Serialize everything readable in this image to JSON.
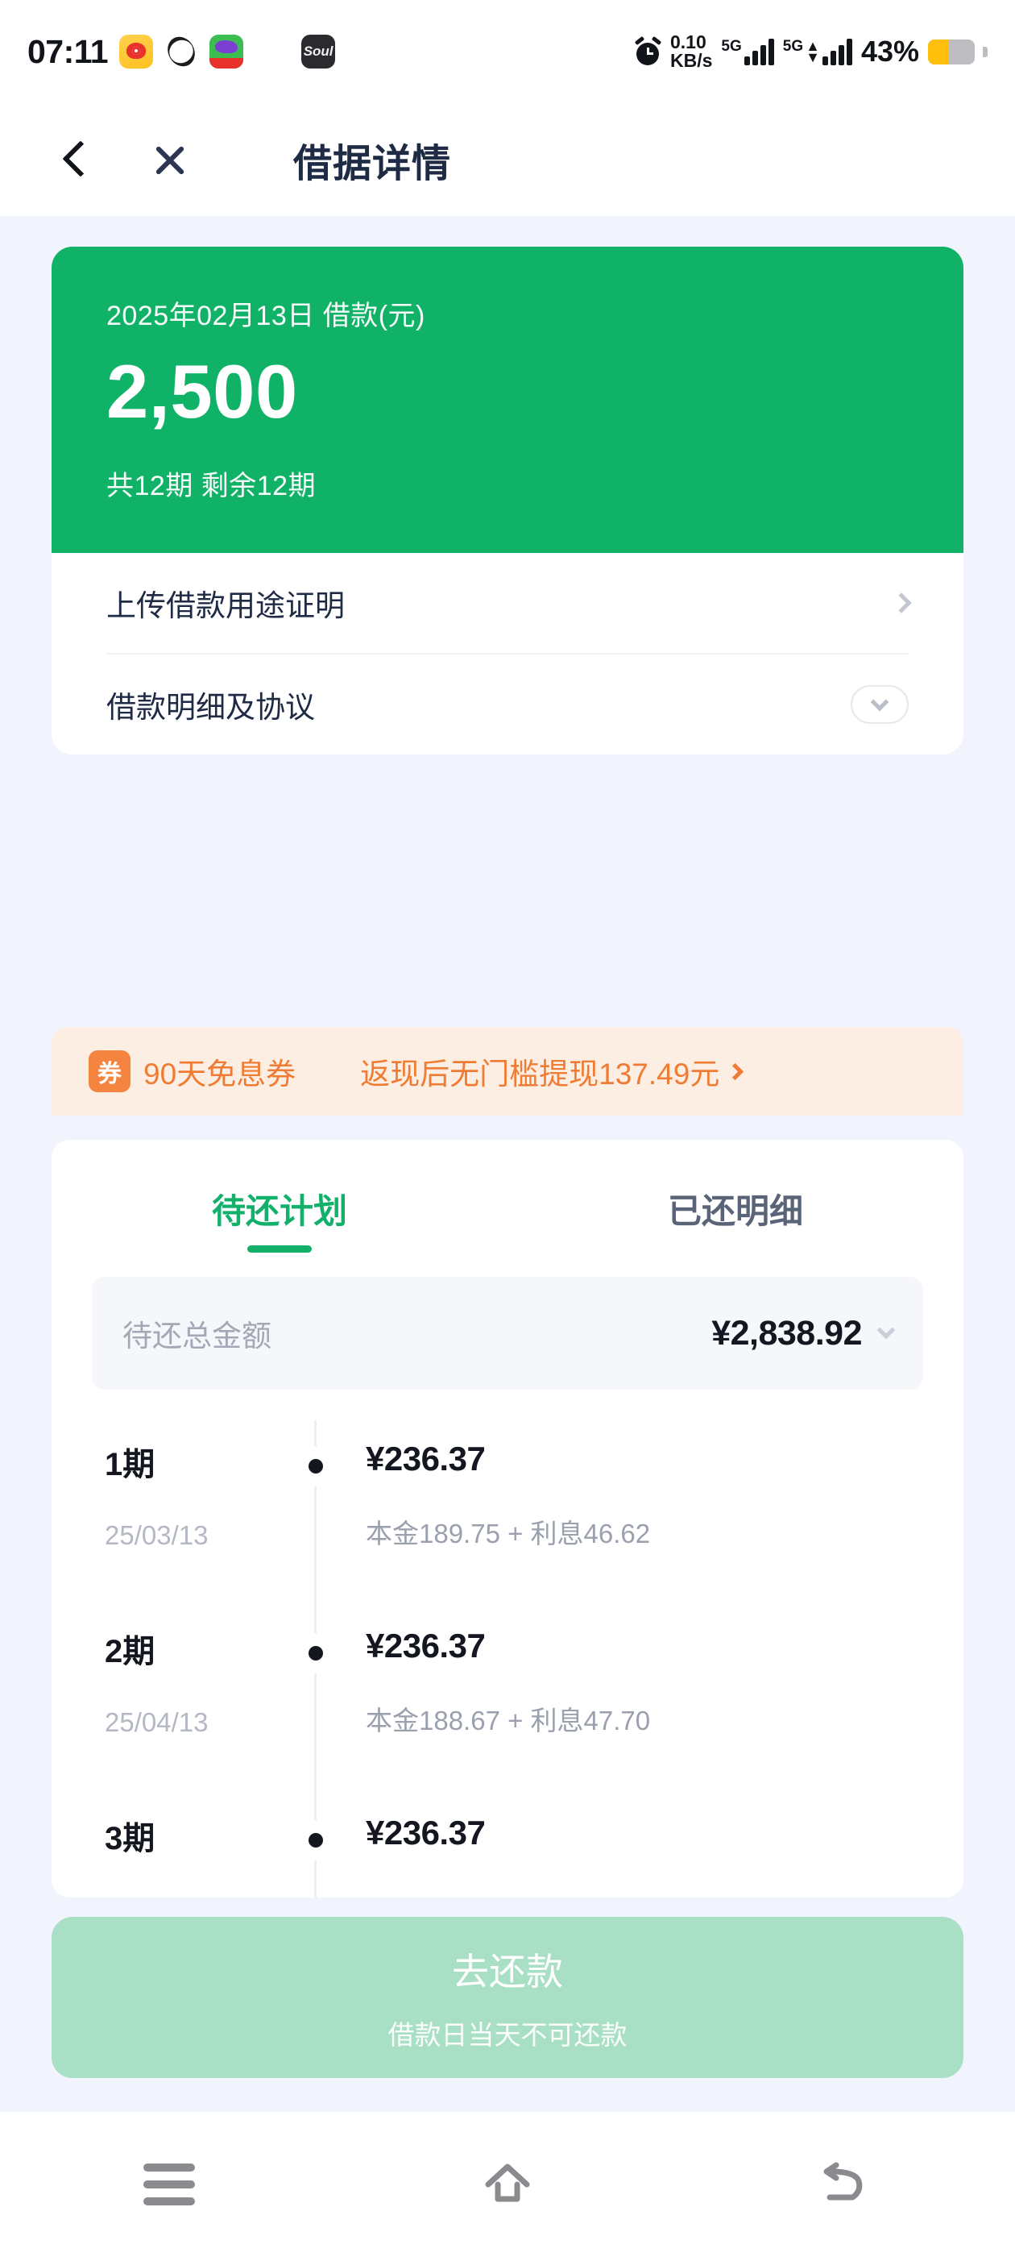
{
  "status_bar": {
    "time": "07:11",
    "notification_icons": [
      "weibo-icon",
      "oval-app-icon",
      "green-app-icon",
      "soul-app-icon"
    ],
    "alarm_icon": "alarm-clock-icon",
    "net_speed_value": "0.10",
    "net_speed_unit": "KB/s",
    "network_1": "5G",
    "network_2": "5G",
    "battery_percent": "43%"
  },
  "header": {
    "back_icon": "back-chevron-icon",
    "close_icon": "close-icon",
    "title": "借据详情"
  },
  "loan_card": {
    "date_label": "2025年02月13日 借款(元)",
    "amount": "2,500",
    "terms": "共12期 剩余12期",
    "rows": [
      {
        "label": "上传借款用途证明",
        "action_icon": "chevron-right-icon"
      },
      {
        "label": "借款明细及协议",
        "action_icon": "chevron-down-icon"
      }
    ]
  },
  "coupon": {
    "badge": "券",
    "name": "90天免息券",
    "description": "返现后无门槛提现137.49元",
    "action_icon": "chevron-right-icon"
  },
  "plan": {
    "tabs": [
      {
        "label": "待还计划",
        "active": true
      },
      {
        "label": "已还明细",
        "active": false
      }
    ],
    "total": {
      "label": "待还总金额",
      "amount": "¥2,838.92",
      "expand_icon": "chevron-down-icon"
    },
    "installments": [
      {
        "period": "1期",
        "date": "25/03/13",
        "amount": "¥236.37",
        "breakdown": "本金189.75 + 利息46.62"
      },
      {
        "period": "2期",
        "date": "25/04/13",
        "amount": "¥236.37",
        "breakdown": "本金188.67 + 利息47.70"
      },
      {
        "period": "3期",
        "date": "",
        "amount": "¥236.37",
        "breakdown": ""
      }
    ]
  },
  "cta": {
    "label": "去还款",
    "sublabel": "借款日当天不可还款",
    "enabled": false
  },
  "navbar": {
    "recents_icon": "recents-icon",
    "home_icon": "home-icon",
    "back_icon": "back-icon"
  },
  "colors": {
    "brand_green": "#0fb266",
    "accent_green": "#12b06a",
    "coupon_orange": "#f07c33",
    "coupon_bg": "#fdeee4",
    "page_bg": "#f1f4fd",
    "cta_disabled": "#a9e0c5",
    "battery_yellow": "#ffbe0a"
  }
}
